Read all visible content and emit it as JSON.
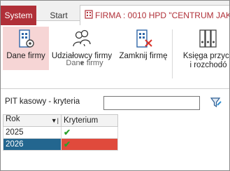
{
  "tabs": {
    "system": "System",
    "start": "Start",
    "firma": "FIRMA : 0010 HPD \"CENTRUM JAKO"
  },
  "ribbon": {
    "dane_firmy": "Dane firmy",
    "udzialowcy": "Udziałowcy firmy",
    "zamknij": "Zamknij firmę",
    "ksiega_line1": "Księga przych",
    "ksiega_line2": "i rozchodó",
    "group_label": "Dane firmy"
  },
  "filter": {
    "label": "PIT kasowy - kryteria",
    "value": ""
  },
  "grid": {
    "headers": [
      "Rok",
      "Kryterium"
    ],
    "rows": [
      {
        "rok": "2025",
        "check": "✔"
      },
      {
        "rok": "2026",
        "check": "✔"
      }
    ]
  },
  "colors": {
    "system_tab": "#b03038",
    "selected_row": "#23668f",
    "selected_criterion": "#e04a3c",
    "check": "#2aa02a"
  }
}
